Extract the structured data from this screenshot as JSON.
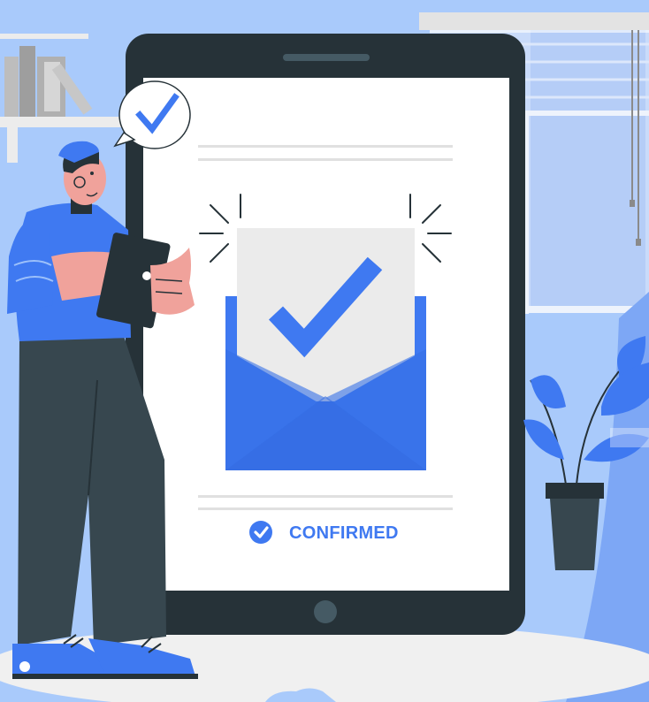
{
  "status": {
    "label": "CONFIRMED",
    "icon": "check-circle-icon"
  },
  "illustration": {
    "envelope_icon": "envelope-check-icon",
    "speech_bubble_icon": "check-speech-bubble-icon"
  },
  "colors": {
    "background": "#A9CAFB",
    "accent_blue": "#3F79F1",
    "tablet_frame": "#263238",
    "envelope_paper": "#EBEBEB",
    "plant_leaf": "#3F79F1"
  }
}
